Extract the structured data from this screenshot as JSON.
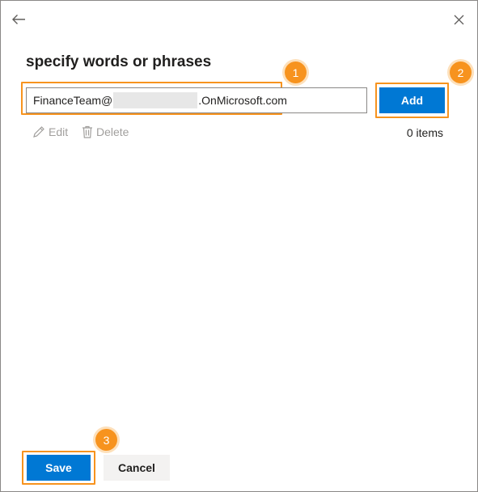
{
  "panel": {
    "title": "specify words or phrases",
    "back_icon": "arrow-left-icon",
    "close_icon": "close-icon"
  },
  "input": {
    "value_prefix": "FinanceTeam@",
    "value_suffix": ".OnMicrosoft.com"
  },
  "actions": {
    "add_label": "Add",
    "edit_label": "Edit",
    "delete_label": "Delete",
    "item_count": "0 items"
  },
  "footer": {
    "save_label": "Save",
    "cancel_label": "Cancel"
  },
  "callouts": [
    "1",
    "2",
    "3"
  ],
  "colors": {
    "primary": "#0078d4",
    "callout": "#f7931e",
    "disabled_text": "#a19f9d",
    "secondary_button": "#f3f2f1"
  }
}
